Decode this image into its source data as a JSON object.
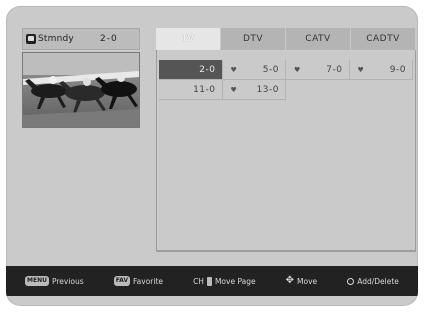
{
  "header": {
    "mode_label": "Stmndy",
    "current_channel": "2-0"
  },
  "tabs": [
    {
      "label": "TV",
      "active": true
    },
    {
      "label": "DTV",
      "active": false
    },
    {
      "label": "CATV",
      "active": false
    },
    {
      "label": "CADTV",
      "active": false
    }
  ],
  "channels": [
    {
      "label": "2-0",
      "favorite": false,
      "selected": true
    },
    {
      "label": "5-0",
      "favorite": true,
      "selected": false
    },
    {
      "label": "7-0",
      "favorite": true,
      "selected": false
    },
    {
      "label": "9-0",
      "favorite": true,
      "selected": false
    },
    {
      "label": "11-0",
      "favorite": false,
      "selected": false
    },
    {
      "label": "13-0",
      "favorite": true,
      "selected": false
    }
  ],
  "favorite_mark": "♥",
  "help": {
    "previous_key": "MENU",
    "previous_label": "Previous",
    "favorite_key": "FAV",
    "favorite_label": "Favorite",
    "page_key": "CH",
    "page_label": "Move Page",
    "move_label": "Move",
    "add_delete_label": "Add/Delete"
  }
}
